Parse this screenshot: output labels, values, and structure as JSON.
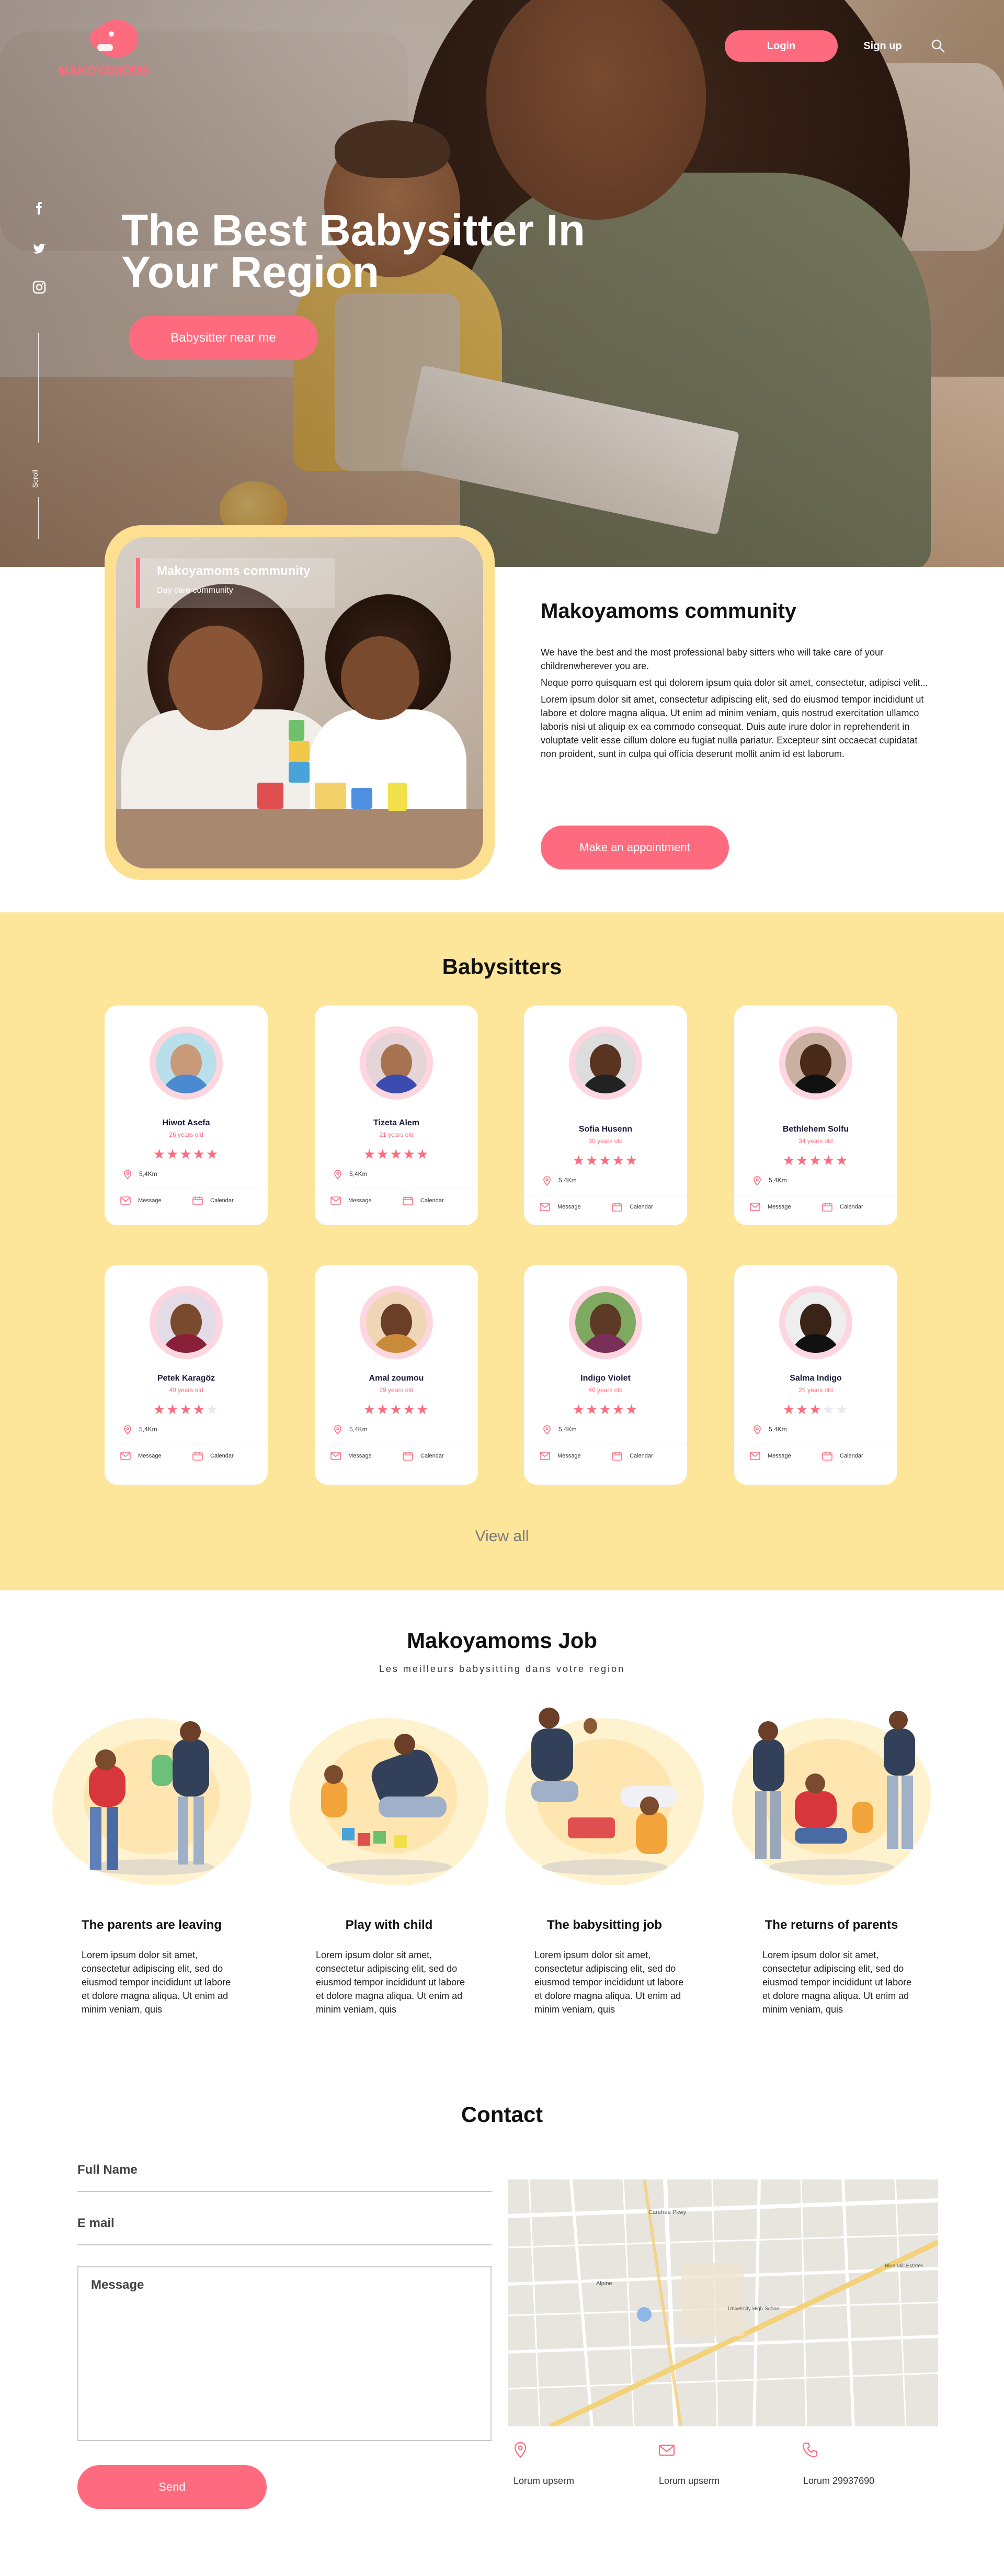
{
  "brand": {
    "name": "MAKOYAMOMS",
    "accent": "#ff6b7e",
    "yellow": "#fde59a"
  },
  "nav": {
    "login": "Login",
    "signup": "Sign up",
    "search_icon": "search-icon"
  },
  "social": [
    "facebook-icon",
    "twitter-icon",
    "instagram-icon"
  ],
  "side": {
    "scroll_label": "Scroll"
  },
  "hero": {
    "title": "The Best Babysitter In Your Region",
    "cta": "Babysitter near me"
  },
  "community": {
    "tag_title": "Makoyamoms community",
    "tag_sub": "Day care community",
    "heading": "Makoyamoms community",
    "para1": "We have the best and the most professional baby sitters who will take care of your childrenwherever you are.",
    "para2": "Neque porro quisquam est qui dolorem ipsum quia dolor sit amet, consectetur, adipisci velit...",
    "para3": "Lorem ipsum dolor sit amet, consectetur adipiscing elit, sed do eiusmod tempor incididunt ut labore et dolore magna aliqua. Ut enim ad minim veniam, quis nostrud exercitation ullamco laboris nisi ut aliquip ex ea commodo consequat. Duis aute irure dolor in reprehenderit in voluptate velit esse cillum dolore eu fugiat nulla pariatur. Excepteur sint occaecat cupidatat non proident, sunt in culpa qui officia deserunt mollit anim id est laborum.",
    "cta": "Make an appointment"
  },
  "sitters": {
    "title": "Babysitters",
    "message_label": "Message",
    "calendar_label": "Calendar",
    "items": [
      {
        "name": "Hiwot Asefa",
        "age": "26 years old",
        "rating": 5,
        "distance": "5,4Km"
      },
      {
        "name": "Tizeta Alem",
        "age": "21 years old",
        "rating": 5,
        "distance": "5,4Km"
      },
      {
        "name": "Sofia Husenn",
        "age": "30 years old",
        "rating": 5,
        "distance": "5,4Km"
      },
      {
        "name": "Bethlehem Solfu",
        "age": "34 years old",
        "rating": 5,
        "distance": "5,4Km"
      },
      {
        "name": "Petek Karagöz",
        "age": "40 years old",
        "rating": 4,
        "distance": "5,4Km"
      },
      {
        "name": "Amal zoumou",
        "age": "29 years old",
        "rating": 5,
        "distance": "5,4Km"
      },
      {
        "name": "Indigo Violet",
        "age": "40 years old",
        "rating": 5,
        "distance": "5,4Km"
      },
      {
        "name": "Salma Indigo",
        "age": "25 years old",
        "rating": 3,
        "distance": "5,4Km"
      }
    ],
    "view_all": "View all"
  },
  "job": {
    "title": "Makoyamoms Job",
    "subtitle": "Les meilleurs babysitting dans votre region",
    "items": [
      {
        "caption": "The parents are leaving",
        "text": "Lorem ipsum dolor sit amet, consectetur adipiscing elit, sed do eiusmod tempor incididunt ut labore et dolore magna aliqua. Ut enim ad minim veniam, quis"
      },
      {
        "caption": "Play with child",
        "text": "Lorem ipsum dolor sit amet, consectetur adipiscing elit, sed do eiusmod tempor incididunt ut labore et dolore magna aliqua. Ut enim ad minim veniam, quis"
      },
      {
        "caption": "The babysitting job",
        "text": "Lorem ipsum dolor sit amet, consectetur adipiscing elit, sed do eiusmod tempor incididunt ut labore et dolore magna aliqua. Ut enim ad minim veniam, quis"
      },
      {
        "caption": "The returns of parents",
        "text": "Lorem ipsum dolor sit amet, consectetur adipiscing elit, sed do eiusmod tempor incididunt ut labore et dolore magna aliqua. Ut enim ad minim veniam, quis"
      }
    ]
  },
  "contact": {
    "title": "Contact",
    "full_name": "Full Name",
    "email": "E mail",
    "message": "Message",
    "send": "Send",
    "map_labels": [
      "Carefree Pkwy",
      "Alpine",
      "University High School",
      "Blue Mill Estates"
    ],
    "info": [
      {
        "icon": "location-icon",
        "text": "Lorum upserm"
      },
      {
        "icon": "mail-icon",
        "text": "Lorum upserm"
      },
      {
        "icon": "phone-icon",
        "text": "Lorum 29937690"
      }
    ]
  }
}
